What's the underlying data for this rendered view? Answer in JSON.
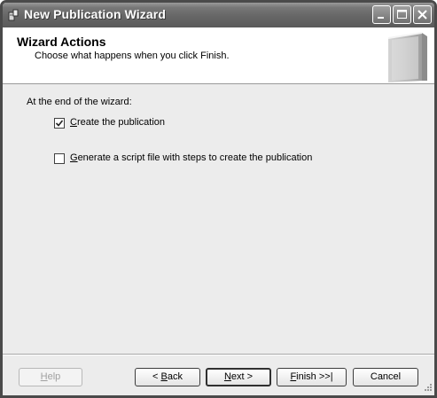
{
  "window": {
    "title": "New Publication Wizard"
  },
  "header": {
    "title": "Wizard Actions",
    "subtitle": "Choose what happens when you click Finish."
  },
  "content": {
    "prompt": "At the end of the wizard:",
    "options": [
      {
        "accel": "C",
        "rest": "reate the publication",
        "checked": true
      },
      {
        "accel": "G",
        "rest": "enerate a script file with steps to create the publication",
        "checked": false
      }
    ]
  },
  "buttons": {
    "help": {
      "accel": "H",
      "rest": "elp",
      "enabled": false
    },
    "back": {
      "prefix": "< ",
      "accel": "B",
      "rest": "ack"
    },
    "next": {
      "accel": "N",
      "rest": "ext >"
    },
    "finish": {
      "accel": "F",
      "rest": "inish >>|"
    },
    "cancel": {
      "label": "Cancel"
    }
  },
  "icons": {
    "title_icon": "wizard-app-icon",
    "header_art": "book-icon",
    "minimize": "minimize-icon",
    "maximize": "maximize-icon",
    "close": "close-icon",
    "check": "check-icon",
    "resize": "resize-grip-icon"
  }
}
